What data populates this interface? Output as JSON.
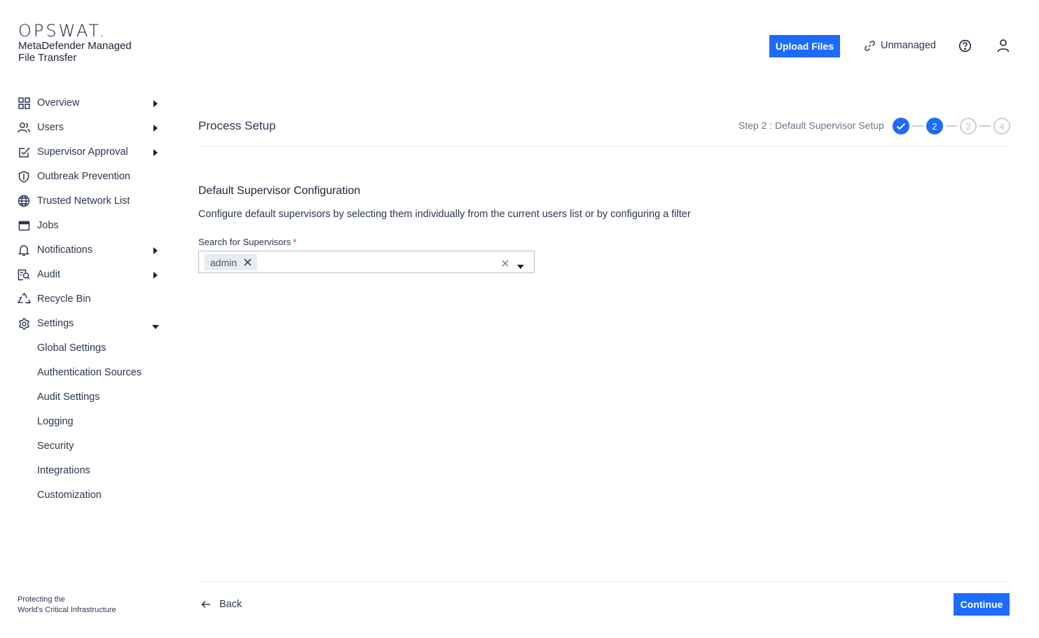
{
  "brand": {
    "logo_text": "OPSWAT.",
    "product_line1": "MetaDefender Managed",
    "product_line2": "File Transfer",
    "tagline_line1": "Protecting the",
    "tagline_line2": "World's Critical Infrastructure"
  },
  "header": {
    "upload_label": "Upload Files",
    "unmanaged_label": "Unmanaged",
    "accent_color": "#1d6bfc"
  },
  "sidebar": {
    "items": [
      {
        "label": "Overview",
        "icon": "grid-icon",
        "expandable": true
      },
      {
        "label": "Users",
        "icon": "users-icon",
        "expandable": true
      },
      {
        "label": "Supervisor Approval",
        "icon": "approval-icon",
        "expandable": true
      },
      {
        "label": "Outbreak Prevention",
        "icon": "shield-icon",
        "expandable": false
      },
      {
        "label": "Trusted Network List",
        "icon": "globe-icon",
        "expandable": false
      },
      {
        "label": "Jobs",
        "icon": "window-icon",
        "expandable": false
      },
      {
        "label": "Notifications",
        "icon": "bell-icon",
        "expandable": true
      },
      {
        "label": "Audit",
        "icon": "audit-icon",
        "expandable": true
      },
      {
        "label": "Recycle Bin",
        "icon": "recycle-icon",
        "expandable": false
      },
      {
        "label": "Settings",
        "icon": "gear-icon",
        "expandable": true,
        "expanded": true
      }
    ],
    "settings_children": [
      "Global Settings",
      "Authentication Sources",
      "Audit Settings",
      "Logging",
      "Security",
      "Integrations",
      "Customization"
    ]
  },
  "main": {
    "title": "Process Setup",
    "step_label": "Step 2 : Default Supervisor Setup",
    "steps": [
      {
        "number": "1",
        "state": "done"
      },
      {
        "number": "2",
        "state": "active"
      },
      {
        "number": "3",
        "state": "todo"
      },
      {
        "number": "4",
        "state": "todo"
      }
    ],
    "section_title": "Default Supervisor Configuration",
    "section_desc": "Configure default supervisors by selecting them individually from the current users list or by configuring a filter",
    "field_label": "Search for Supervisors",
    "required_mark": "*",
    "selected_chips": [
      "admin"
    ]
  },
  "footer": {
    "back_label": "Back",
    "continue_label": "Continue"
  }
}
